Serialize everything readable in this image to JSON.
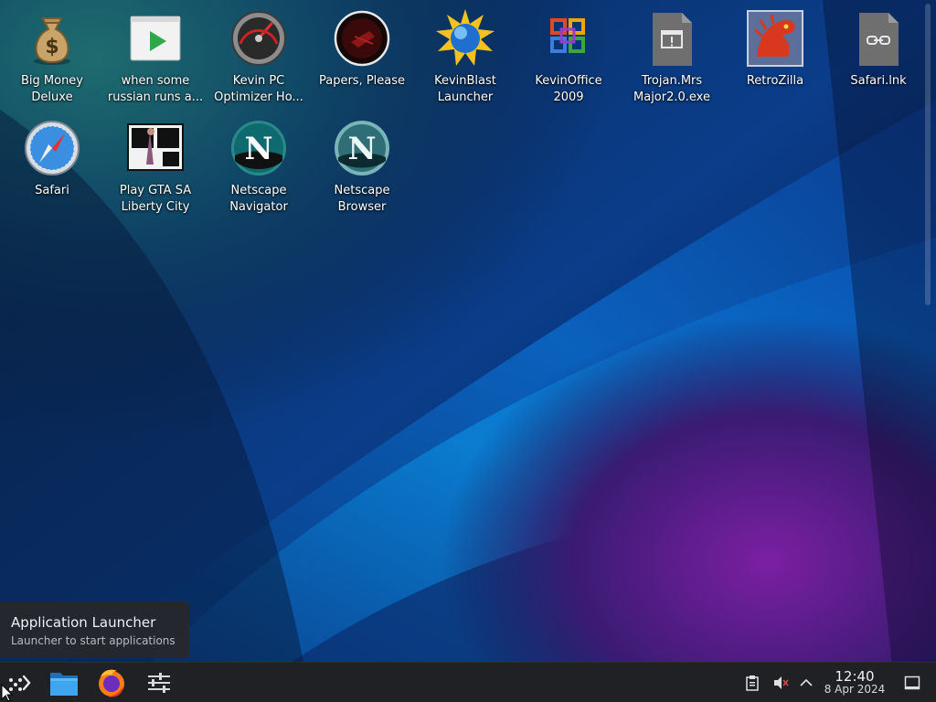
{
  "desktop": {
    "icons": [
      {
        "label": "Big Money Deluxe",
        "line1": "Big Money",
        "line2": "Deluxe"
      },
      {
        "label": "when some russian runs a...",
        "line1": "when some",
        "line2": "russian runs a..."
      },
      {
        "label": "Kevin PC Optimizer Ho...",
        "line1": "Kevin PC",
        "line2": "Optimizer Ho..."
      },
      {
        "label": "Papers, Please",
        "line1": "Papers, Please",
        "line2": ""
      },
      {
        "label": "KevinBlast Launcher",
        "line1": "KevinBlast",
        "line2": "Launcher"
      },
      {
        "label": "KevinOffice 2009",
        "line1": "KevinOffice",
        "line2": "2009"
      },
      {
        "label": "Trojan.Mrs Major2.0.exe",
        "line1": "Trojan.Mrs",
        "line2": "Major2.0.exe"
      },
      {
        "label": "RetroZilla",
        "line1": "RetroZilla",
        "line2": ""
      },
      {
        "label": "Safari.lnk",
        "line1": "Safari.lnk",
        "line2": ""
      },
      {
        "label": "Safari",
        "line1": "Safari",
        "line2": ""
      },
      {
        "label": "Play GTA SA Liberty City",
        "line1": "Play GTA SA",
        "line2": "Liberty City"
      },
      {
        "label": "Netscape Navigator",
        "line1": "Netscape",
        "line2": "Navigator"
      },
      {
        "label": "Netscape Browser",
        "line1": "Netscape",
        "line2": "Browser"
      }
    ]
  },
  "tooltip": {
    "title": "Application Launcher",
    "subtitle": "Launcher to start applications"
  },
  "taskbar": {
    "launcher_icon": "application-launcher-icon",
    "pinned": [
      "file-manager-icon",
      "firefox-icon",
      "mixer-settings-icon"
    ],
    "tray": [
      "clipboard-icon",
      "volume-muted-icon",
      "tray-expand-chevron-icon"
    ],
    "show_desktop_icon": "show-desktop-icon"
  },
  "clock": {
    "time": "12:40",
    "date": "8 Apr 2024"
  },
  "colors": {
    "taskbar_bg": "#1f2124",
    "wallpaper_blue": "#0a4db0",
    "wallpaper_purple": "#5a1a8a",
    "tooltip_bg": "#26282c"
  }
}
